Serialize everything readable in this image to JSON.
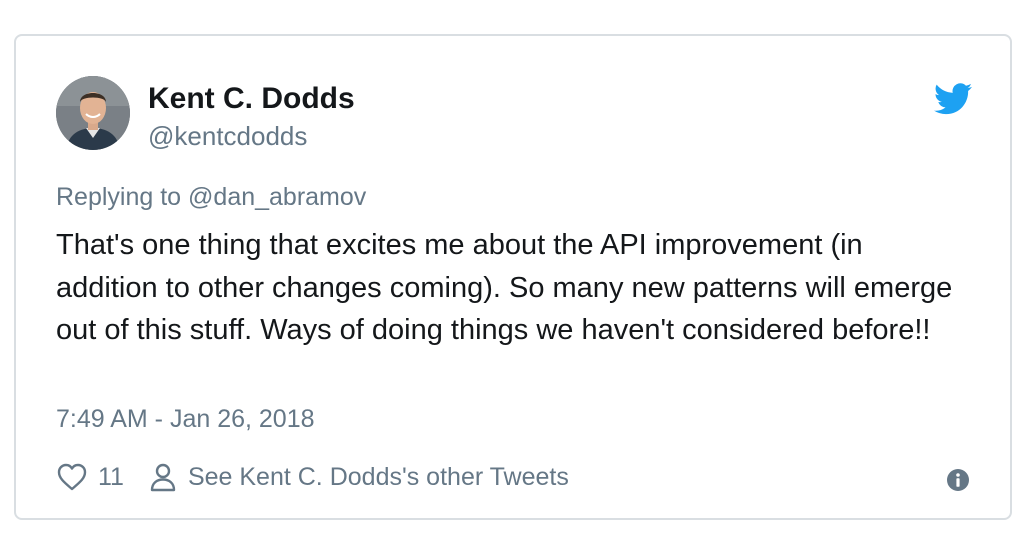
{
  "author": {
    "display_name": "Kent C. Dodds",
    "handle": "@kentcdodds"
  },
  "reply": {
    "prefix": "Replying to ",
    "mention": "@dan_abramov"
  },
  "tweet": {
    "text": "That's one thing that excites me about the API improvement (in addition to other changes coming). So many new patterns will emerge out of this stuff. Ways of doing things we haven't considered before!!",
    "timestamp": "7:49 AM - Jan 26, 2018"
  },
  "actions": {
    "like_count": "11",
    "other_tweets_label": "See Kent C. Dodds's other Tweets"
  },
  "icons": {
    "brand": "twitter-bird-icon",
    "like": "heart-icon",
    "profile": "person-icon",
    "info": "info-icon"
  },
  "colors": {
    "brand_blue": "#1da1f2",
    "text_primary": "#14171a",
    "text_secondary": "#657786",
    "border": "#d9dee2"
  }
}
